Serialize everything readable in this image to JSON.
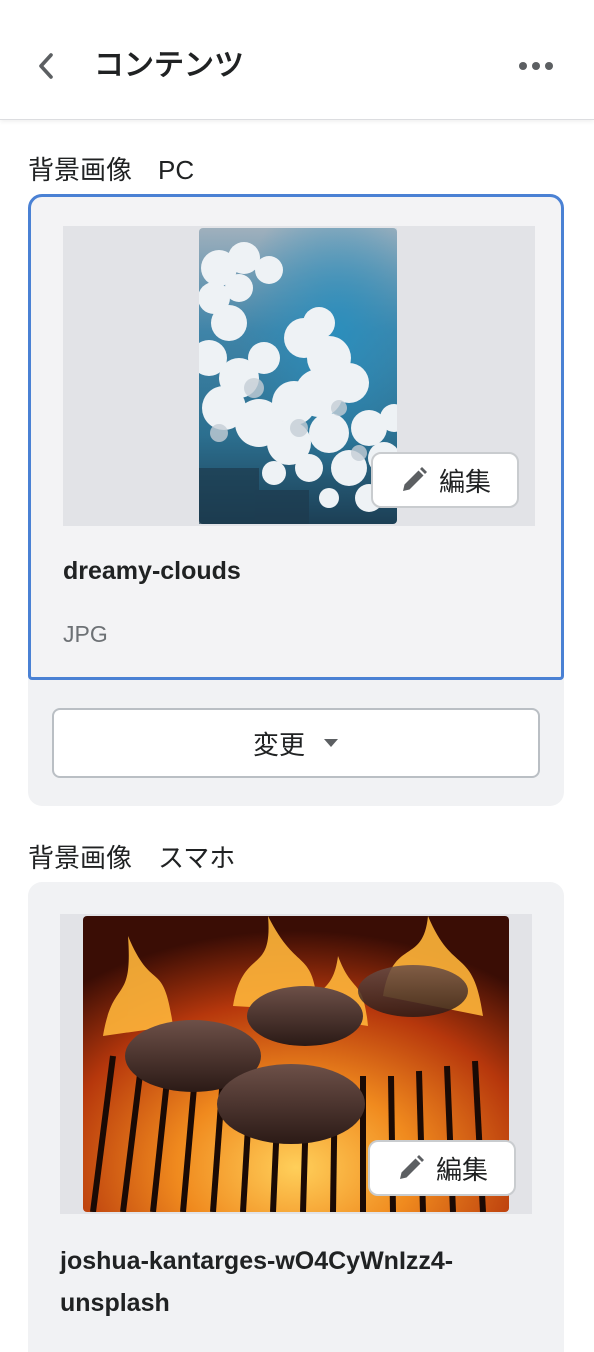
{
  "header": {
    "title": "コンテンツ",
    "back_icon": "chevron-left-icon",
    "more_icon": "more-horizontal-icon"
  },
  "sections": [
    {
      "label": "背景画像　PC",
      "file_name": "dreamy-clouds",
      "file_type": "JPG",
      "edit_label": "編集",
      "change_label": "変更",
      "image_subject": "clouds"
    },
    {
      "label": "背景画像　スマホ",
      "file_name_line1": "joshua-kantarges-wO4CyWnIzz4-",
      "file_name_line2": "unsplash",
      "edit_label": "編集",
      "image_subject": "burgers-on-grill"
    }
  ],
  "colors": {
    "focus_border": "#4a81d4",
    "card_bg": "#f1f2f4",
    "text_primary": "#202223",
    "text_subdued": "#6d7175"
  }
}
